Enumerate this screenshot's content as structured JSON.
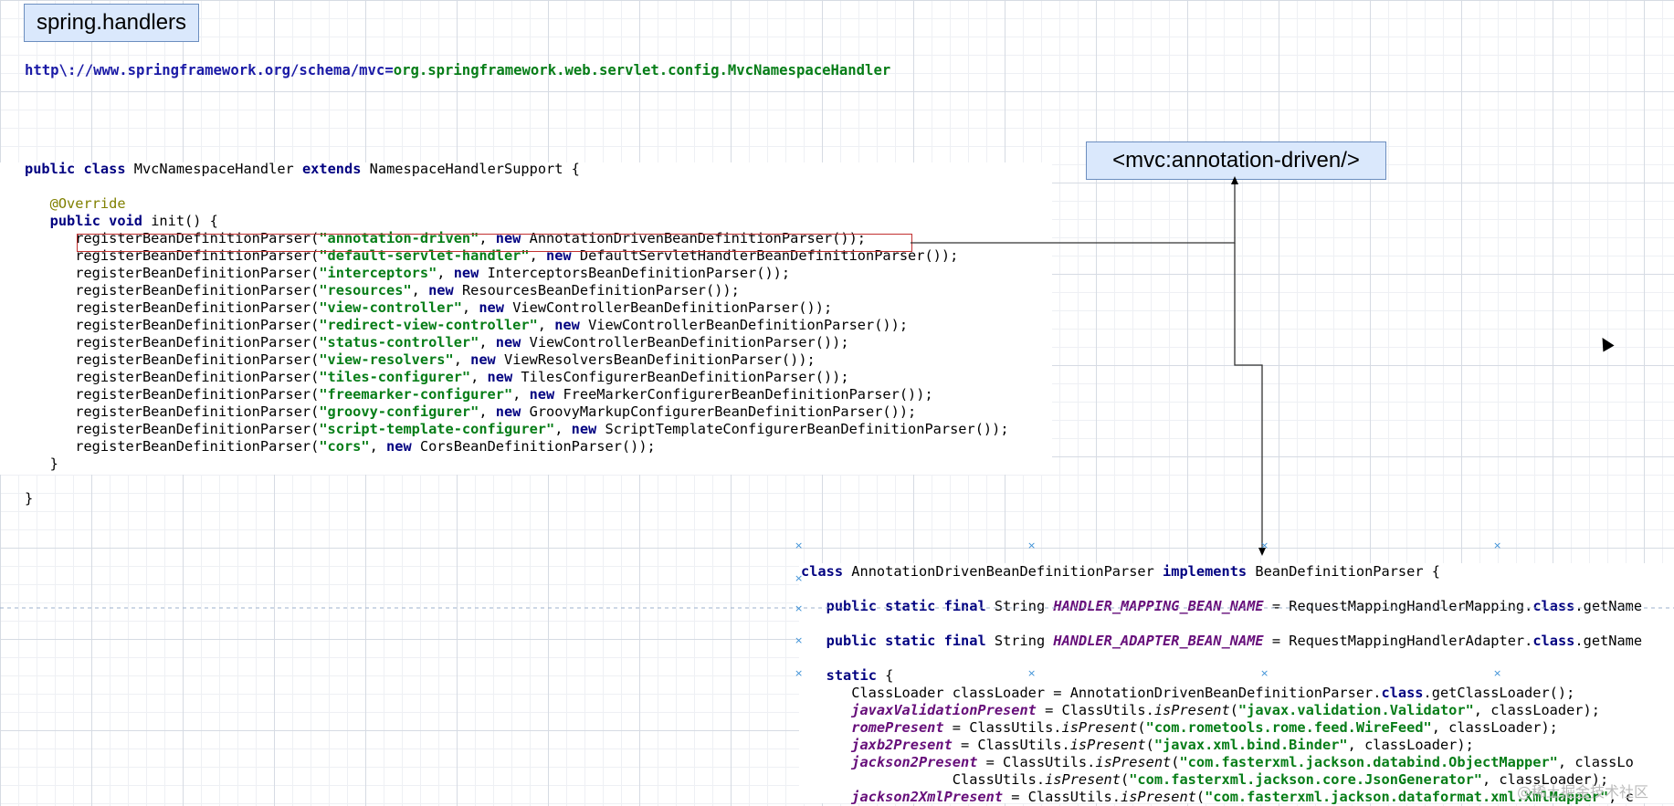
{
  "boxes": {
    "title": "spring.handlers",
    "mvc": "<mvc:annotation-driven/>"
  },
  "mapping": {
    "key": "http\\://www.springframework.org/schema/mvc",
    "eq": "=",
    "value": "org.springframework.web.servlet.config.MvcNamespaceHandler"
  },
  "handler": {
    "kw_public": "public",
    "kw_class": "class",
    "class_name": "MvcNamespaceHandler",
    "kw_extends": "extends",
    "parent": "NamespaceHandlerSupport {",
    "override": "@Override",
    "kw_void": "void",
    "init": "init() {",
    "call": "registerBeanDefinitionParser(",
    "kw_new": "new",
    "registrations": [
      {
        "name": "\"annotation-driven\"",
        "parser": "AnnotationDrivenBeanDefinitionParser());"
      },
      {
        "name": "\"default-servlet-handler\"",
        "parser": "DefaultServletHandlerBeanDefinitionParser());"
      },
      {
        "name": "\"interceptors\"",
        "parser": "InterceptorsBeanDefinitionParser());"
      },
      {
        "name": "\"resources\"",
        "parser": "ResourcesBeanDefinitionParser());"
      },
      {
        "name": "\"view-controller\"",
        "parser": "ViewControllerBeanDefinitionParser());"
      },
      {
        "name": "\"redirect-view-controller\"",
        "parser": "ViewControllerBeanDefinitionParser());"
      },
      {
        "name": "\"status-controller\"",
        "parser": "ViewControllerBeanDefinitionParser());"
      },
      {
        "name": "\"view-resolvers\"",
        "parser": "ViewResolversBeanDefinitionParser());"
      },
      {
        "name": "\"tiles-configurer\"",
        "parser": "TilesConfigurerBeanDefinitionParser());"
      },
      {
        "name": "\"freemarker-configurer\"",
        "parser": "FreeMarkerConfigurerBeanDefinitionParser());"
      },
      {
        "name": "\"groovy-configurer\"",
        "parser": "GroovyMarkupConfigurerBeanDefinitionParser());"
      },
      {
        "name": "\"script-template-configurer\"",
        "parser": "ScriptTemplateConfigurerBeanDefinitionParser());"
      },
      {
        "name": "\"cors\"",
        "parser": "CorsBeanDefinitionParser());"
      }
    ],
    "close_method": "}",
    "close_class": "}"
  },
  "parser": {
    "kw_class": "class",
    "class_name": "AnnotationDrivenBeanDefinitionParser",
    "kw_implements": "implements",
    "iface": "BeanDefinitionParser {",
    "kw_public": "public",
    "kw_static": "static",
    "kw_final": "final",
    "type_string": "String",
    "handler_mapping_name": "HANDLER_MAPPING_BEAN_NAME",
    "handler_mapping_value": "= RequestMappingHandlerMapping.",
    "handler_adapter_name": "HANDLER_ADAPTER_BEAN_NAME",
    "handler_adapter_value": "= RequestMappingHandlerAdapter.",
    "kw_class_ref": "class",
    "get_name": ".getName",
    "static_block": "{",
    "classloader_line": "ClassLoader classLoader = AnnotationDrivenBeanDefinitionParser.",
    "classloader_tail": ".getClassLoader();",
    "eq_classutils": " = ClassUtils.",
    "is_present": "isPresent",
    "open_paren": "(",
    "loader_tail": ", classLoader);",
    "javax_field": "javaxValidationPresent",
    "javax_str": "\"javax.validation.Validator\"",
    "rome_field": "romePresent",
    "rome_str": "\"com.rometools.rome.feed.WireFeed\"",
    "jaxb_field": "jaxb2Present",
    "jaxb_str": "\"javax.xml.bind.Binder\"",
    "jackson_field": "jackson2Present",
    "jackson_str": "\"com.fasterxml.jackson.databind.ObjectMapper\"",
    "jackson_tail": ", classLo",
    "jackson_cont_prefix": "ClassUtils.",
    "jackson_cont_str": "\"com.fasterxml.jackson.core.JsonGenerator\"",
    "jackson_cont_tail": ", classLoader);",
    "jacksonxml_field": "jackson2XmlPresent",
    "jacksonxml_str": "\"com.fasterxml.jackson.dataformat.xml.XmlMapper\"",
    "jacksonxml_tail": ", c"
  },
  "watermark": "@稀土掘金技术社区"
}
